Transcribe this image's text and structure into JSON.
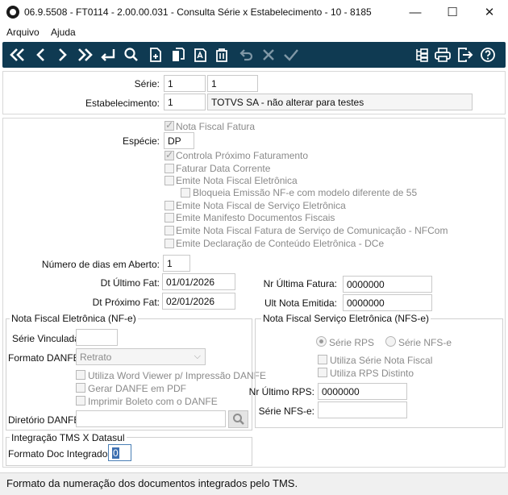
{
  "window": {
    "title": "06.9.5508 - FT0114 - 2.00.00.031 - Consulta Série x Estabelecimento - 10 - 8185",
    "minimize": "—",
    "maximize": "☐",
    "close": "✕"
  },
  "menu": {
    "items": [
      "Arquivo",
      "Ajuda"
    ]
  },
  "toolbar": {
    "buttons": [
      "first-icon",
      "previous-icon",
      "next-icon",
      "last-icon",
      "goto-icon",
      "search-icon",
      "add-icon",
      "copy-icon",
      "edit-icon",
      "edit-doc-icon",
      "delete-icon",
      "undo-icon",
      "cancel-icon",
      "confirm-icon",
      "tree-icon",
      "print-icon",
      "exit-icon",
      "help-icon"
    ]
  },
  "header": {
    "serie_label": "Série:",
    "serie_value": "1",
    "serie_value2": "1",
    "estab_label": "Estabelecimento:",
    "estab_code": "1",
    "estab_name": "TOTVS SA - não alterar para testes"
  },
  "main": {
    "nota_fiscal_fatura": "Nota Fiscal Fatura",
    "especie_label": "Espécie:",
    "especie_value": "DP",
    "controla_proximo": "Controla Próximo Faturamento",
    "faturar_data": "Faturar Data Corrente",
    "emite_nfe": "Emite Nota Fiscal Eletrônica",
    "bloqueia_emissao": "Bloqueia Emissão NF-e com modelo diferente de 55",
    "emite_nfse": "Emite Nota Fiscal de Serviço Eletrônica",
    "emite_manifesto": "Emite Manifesto Documentos Fiscais",
    "emite_nfcom": "Emite Nota Fiscal Fatura de Serviço de Comunicação - NFCom",
    "emite_dce": "Emite Declaração de Conteúdo Eletrônica - DCe",
    "dias_aberto_label": "Número de dias em Aberto:",
    "dias_aberto_value": "1",
    "dt_ultimo_label": "Dt Último Fat:",
    "dt_ultimo_value": "01/01/2026",
    "dt_proximo_label": "Dt Próximo Fat:",
    "dt_proximo_value": "02/01/2026",
    "nr_ultima_label": "Nr Última Fatura:",
    "nr_ultima_value": "0000000",
    "ult_nota_label": "Ult Nota Emitida:",
    "ult_nota_value": "0000000"
  },
  "nfe": {
    "title": "Nota Fiscal Eletrônica (NF-e)",
    "serie_vinculada_label": "Série Vinculada:",
    "serie_vinculada_value": "",
    "formato_label": "Formato DANFE:",
    "formato_value": "Retrato",
    "word_viewer": "Utiliza Word Viewer p/ Impressão DANFE",
    "gerar_pdf": "Gerar DANFE em PDF",
    "imprimir_boleto": "Imprimir Boleto com o DANFE",
    "diretorio_label": "Diretório DANFE:",
    "diretorio_value": ""
  },
  "nfse": {
    "title": "Nota Fiscal Serviço Eletrônica (NFS-e)",
    "serie_rps": "Série RPS",
    "serie_nfse": "Série NFS-e",
    "utiliza_serie": "Utiliza Série Nota Fiscal",
    "utiliza_rps": "Utiliza RPS Distinto",
    "nr_ultimo_rps_label": "Nr Último RPS:",
    "nr_ultimo_rps_value": "0000000",
    "serie_nfse_label": "Série NFS-e:",
    "serie_nfse_value": ""
  },
  "tms": {
    "title": "Integração TMS X Datasul",
    "formato_label": "Formato Doc Integrados:",
    "formato_value": "0"
  },
  "status": {
    "text": "Formato da numeração dos documentos integrados pelo TMS."
  },
  "colors": {
    "toolbar_bg": "#0f3a52",
    "toolbar_icon": "#ffffff"
  }
}
